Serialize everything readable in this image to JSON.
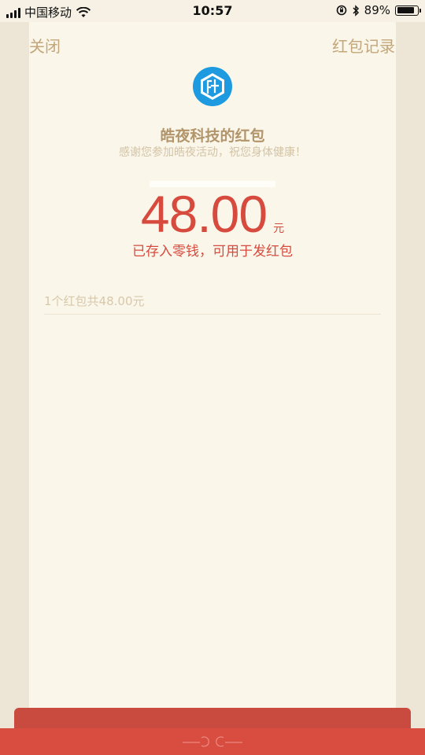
{
  "status_bar": {
    "carrier": "中国移动",
    "time": "10:57",
    "battery_percent": "89%",
    "battery_level": 0.89,
    "icons": [
      "signal-icon",
      "wifi-icon",
      "orientation-lock-icon",
      "bluetooth-icon",
      "battery-icon"
    ]
  },
  "header": {
    "close_label": "关闭",
    "records_label": "红包记录"
  },
  "packet": {
    "logo_icon": "company-logo-hexagon",
    "title": "皓夜科技的红包",
    "greeting": "感谢您参加皓夜活动，祝您身体健康！",
    "amount": "48.00",
    "unit": "元",
    "note": "已存入零钱，可用于发红包",
    "summary": "1个红包共48.00元"
  },
  "colors": {
    "accent_red": "#d74a3e",
    "gold_text": "#c3a77a",
    "card_bg": "#faf6ea",
    "page_bg": "#ede6d6",
    "logo_blue": "#1e9ae0"
  }
}
